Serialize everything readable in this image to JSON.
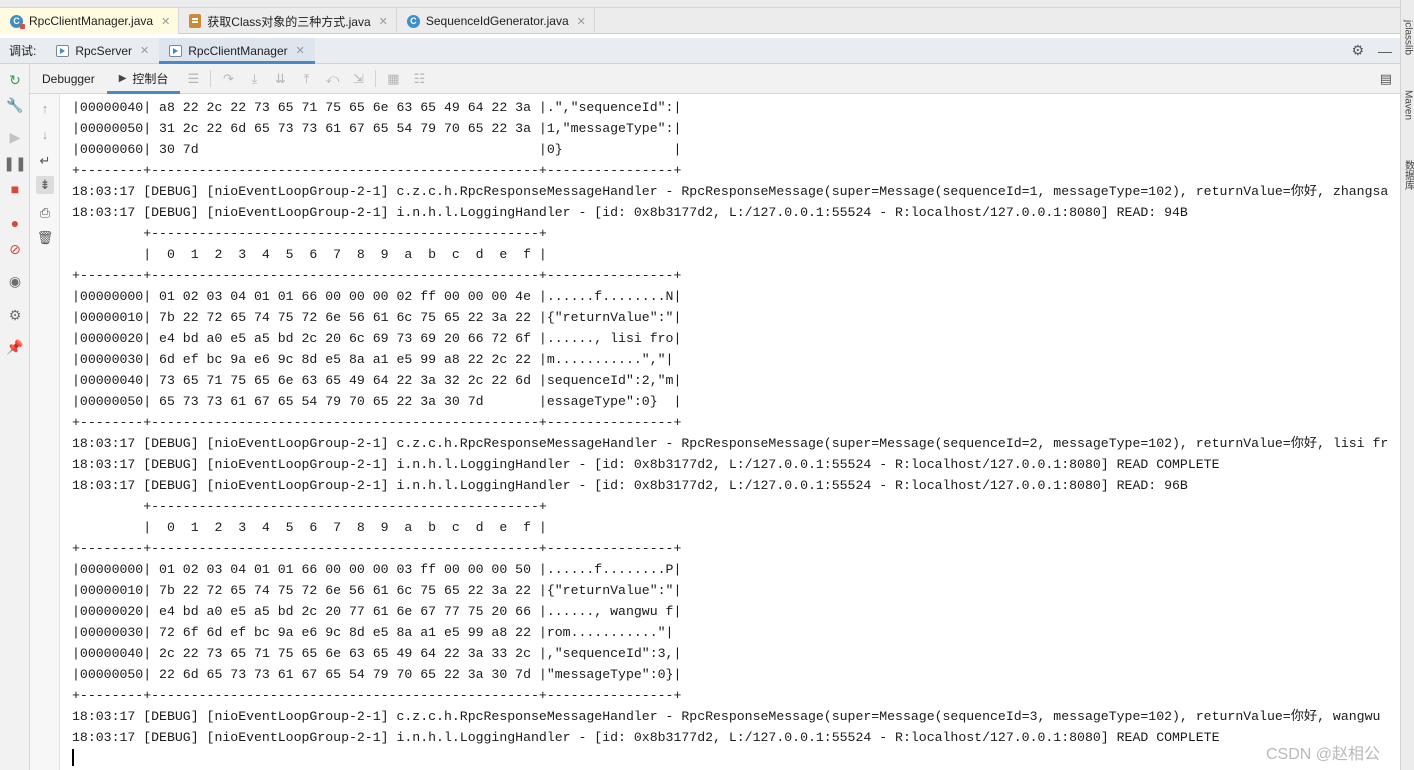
{
  "editor_tabs": [
    {
      "label": "RpcClientManager.java",
      "icon": "class-icon",
      "active": true
    },
    {
      "label": "获取Class对象的三种方式.java",
      "icon": "markdown-file-icon"
    },
    {
      "label": "SequenceIdGenerator.java",
      "icon": "class-icon"
    }
  ],
  "debug_bar": {
    "label": "调试:",
    "tabs": [
      {
        "label": "RpcServer",
        "icon": "run-config-icon"
      },
      {
        "label": "RpcClientManager",
        "icon": "run-config-icon",
        "active": true
      }
    ]
  },
  "console_toolbar": {
    "tabs": [
      {
        "label": "Debugger"
      },
      {
        "label": "控制台",
        "active": true
      }
    ]
  },
  "right_sidebar": {
    "items": [
      "jclasslib",
      "Maven",
      "数据库"
    ]
  },
  "console": {
    "lines": [
      "|00000040| a8 22 2c 22 73 65 71 75 65 6e 63 65 49 64 22 3a |.\",\"sequenceId\":|",
      "|00000050| 31 2c 22 6d 65 73 73 61 67 65 54 79 70 65 22 3a |1,\"messageType\":|",
      "|00000060| 30 7d                                           |0}              |",
      "+--------+-------------------------------------------------+----------------+",
      "18:03:17 [DEBUG] [nioEventLoopGroup-2-1] c.z.c.h.RpcResponseMessageHandler - RpcResponseMessage(super=Message(sequenceId=1, messageType=102), returnValue=你好, zhangsa",
      "18:03:17 [DEBUG] [nioEventLoopGroup-2-1] i.n.h.l.LoggingHandler - [id: 0x8b3177d2, L:/127.0.0.1:55524 - R:localhost/127.0.0.1:8080] READ: 94B",
      "         +-------------------------------------------------+",
      "         |  0  1  2  3  4  5  6  7  8  9  a  b  c  d  e  f |",
      "+--------+-------------------------------------------------+----------------+",
      "|00000000| 01 02 03 04 01 01 66 00 00 00 02 ff 00 00 00 4e |......f........N|",
      "|00000010| 7b 22 72 65 74 75 72 6e 56 61 6c 75 65 22 3a 22 |{\"returnValue\":\"|",
      "|00000020| e4 bd a0 e5 a5 bd 2c 20 6c 69 73 69 20 66 72 6f |......, lisi fro|",
      "|00000030| 6d ef bc 9a e6 9c 8d e5 8a a1 e5 99 a8 22 2c 22 |m...........\",\"|",
      "|00000040| 73 65 71 75 65 6e 63 65 49 64 22 3a 32 2c 22 6d |sequenceId\":2,\"m|",
      "|00000050| 65 73 73 61 67 65 54 79 70 65 22 3a 30 7d       |essageType\":0}  |",
      "+--------+-------------------------------------------------+----------------+",
      "18:03:17 [DEBUG] [nioEventLoopGroup-2-1] c.z.c.h.RpcResponseMessageHandler - RpcResponseMessage(super=Message(sequenceId=2, messageType=102), returnValue=你好, lisi fr",
      "18:03:17 [DEBUG] [nioEventLoopGroup-2-1] i.n.h.l.LoggingHandler - [id: 0x8b3177d2, L:/127.0.0.1:55524 - R:localhost/127.0.0.1:8080] READ COMPLETE",
      "18:03:17 [DEBUG] [nioEventLoopGroup-2-1] i.n.h.l.LoggingHandler - [id: 0x8b3177d2, L:/127.0.0.1:55524 - R:localhost/127.0.0.1:8080] READ: 96B",
      "         +-------------------------------------------------+",
      "         |  0  1  2  3  4  5  6  7  8  9  a  b  c  d  e  f |",
      "+--------+-------------------------------------------------+----------------+",
      "|00000000| 01 02 03 04 01 01 66 00 00 00 03 ff 00 00 00 50 |......f........P|",
      "|00000010| 7b 22 72 65 74 75 72 6e 56 61 6c 75 65 22 3a 22 |{\"returnValue\":\"|",
      "|00000020| e4 bd a0 e5 a5 bd 2c 20 77 61 6e 67 77 75 20 66 |......, wangwu f|",
      "|00000030| 72 6f 6d ef bc 9a e6 9c 8d e5 8a a1 e5 99 a8 22 |rom...........\"|",
      "|00000040| 2c 22 73 65 71 75 65 6e 63 65 49 64 22 3a 33 2c |,\"sequenceId\":3,|",
      "|00000050| 22 6d 65 73 73 61 67 65 54 79 70 65 22 3a 30 7d |\"messageType\":0}|",
      "+--------+-------------------------------------------------+----------------+",
      "18:03:17 [DEBUG] [nioEventLoopGroup-2-1] c.z.c.h.RpcResponseMessageHandler - RpcResponseMessage(super=Message(sequenceId=3, messageType=102), returnValue=你好, wangwu",
      "18:03:17 [DEBUG] [nioEventLoopGroup-2-1] i.n.h.l.LoggingHandler - [id: 0x8b3177d2, L:/127.0.0.1:55524 - R:localhost/127.0.0.1:8080] READ COMPLETE"
    ]
  },
  "watermark": "CSDN @赵相公"
}
